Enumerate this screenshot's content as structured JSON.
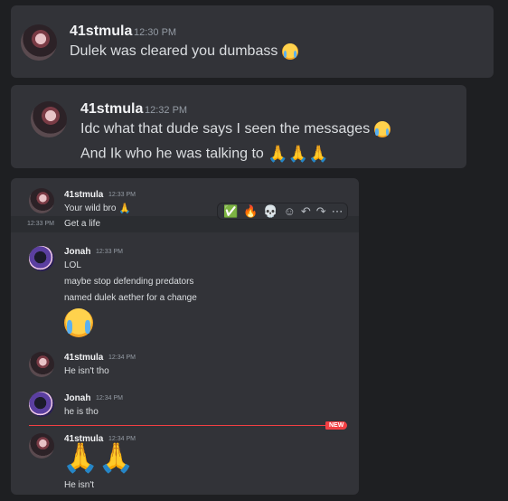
{
  "card1": {
    "username": "41stmula",
    "timestamp": "12:30 PM",
    "text": "Dulek was cleared you dumbass",
    "emoji": "loudly-crying-face"
  },
  "card2": {
    "username": "41stmula",
    "timestamp": "12:32 PM",
    "line1": "Idc what that dude says I seen the messages",
    "line1_emoji": "loudly-crying-face",
    "line2": "And Ik who he was talking to",
    "line2_emoji": "folded-hands x3"
  },
  "card3": {
    "toolbar": [
      "✅",
      "🔥",
      "💀",
      "☺",
      "↶",
      "↷",
      "⋯"
    ],
    "messages": [
      {
        "username": "41stmula",
        "timestamp": "12:33 PM",
        "text": "Your wild bro"
      },
      {
        "hover_timestamp": "12:33 PM",
        "text": "Get a life"
      },
      {
        "username": "Jonah",
        "timestamp": "12:33 PM",
        "lines": [
          "LOL",
          "maybe stop defending predators",
          "named dulek aether for a change"
        ]
      },
      {
        "username": "41stmula",
        "timestamp": "12:34 PM",
        "text": "He isn't tho"
      },
      {
        "username": "Jonah",
        "timestamp": "12:34 PM",
        "text": "he is tho"
      },
      {
        "username": "41stmula",
        "timestamp": "12:34 PM",
        "text": "He isn't"
      }
    ],
    "new_label": "NEW"
  },
  "colors": {
    "background": "#1e1f22",
    "card": "#323338",
    "text": "#dbdee1",
    "muted": "#949ba4",
    "new": "#f23f43"
  }
}
